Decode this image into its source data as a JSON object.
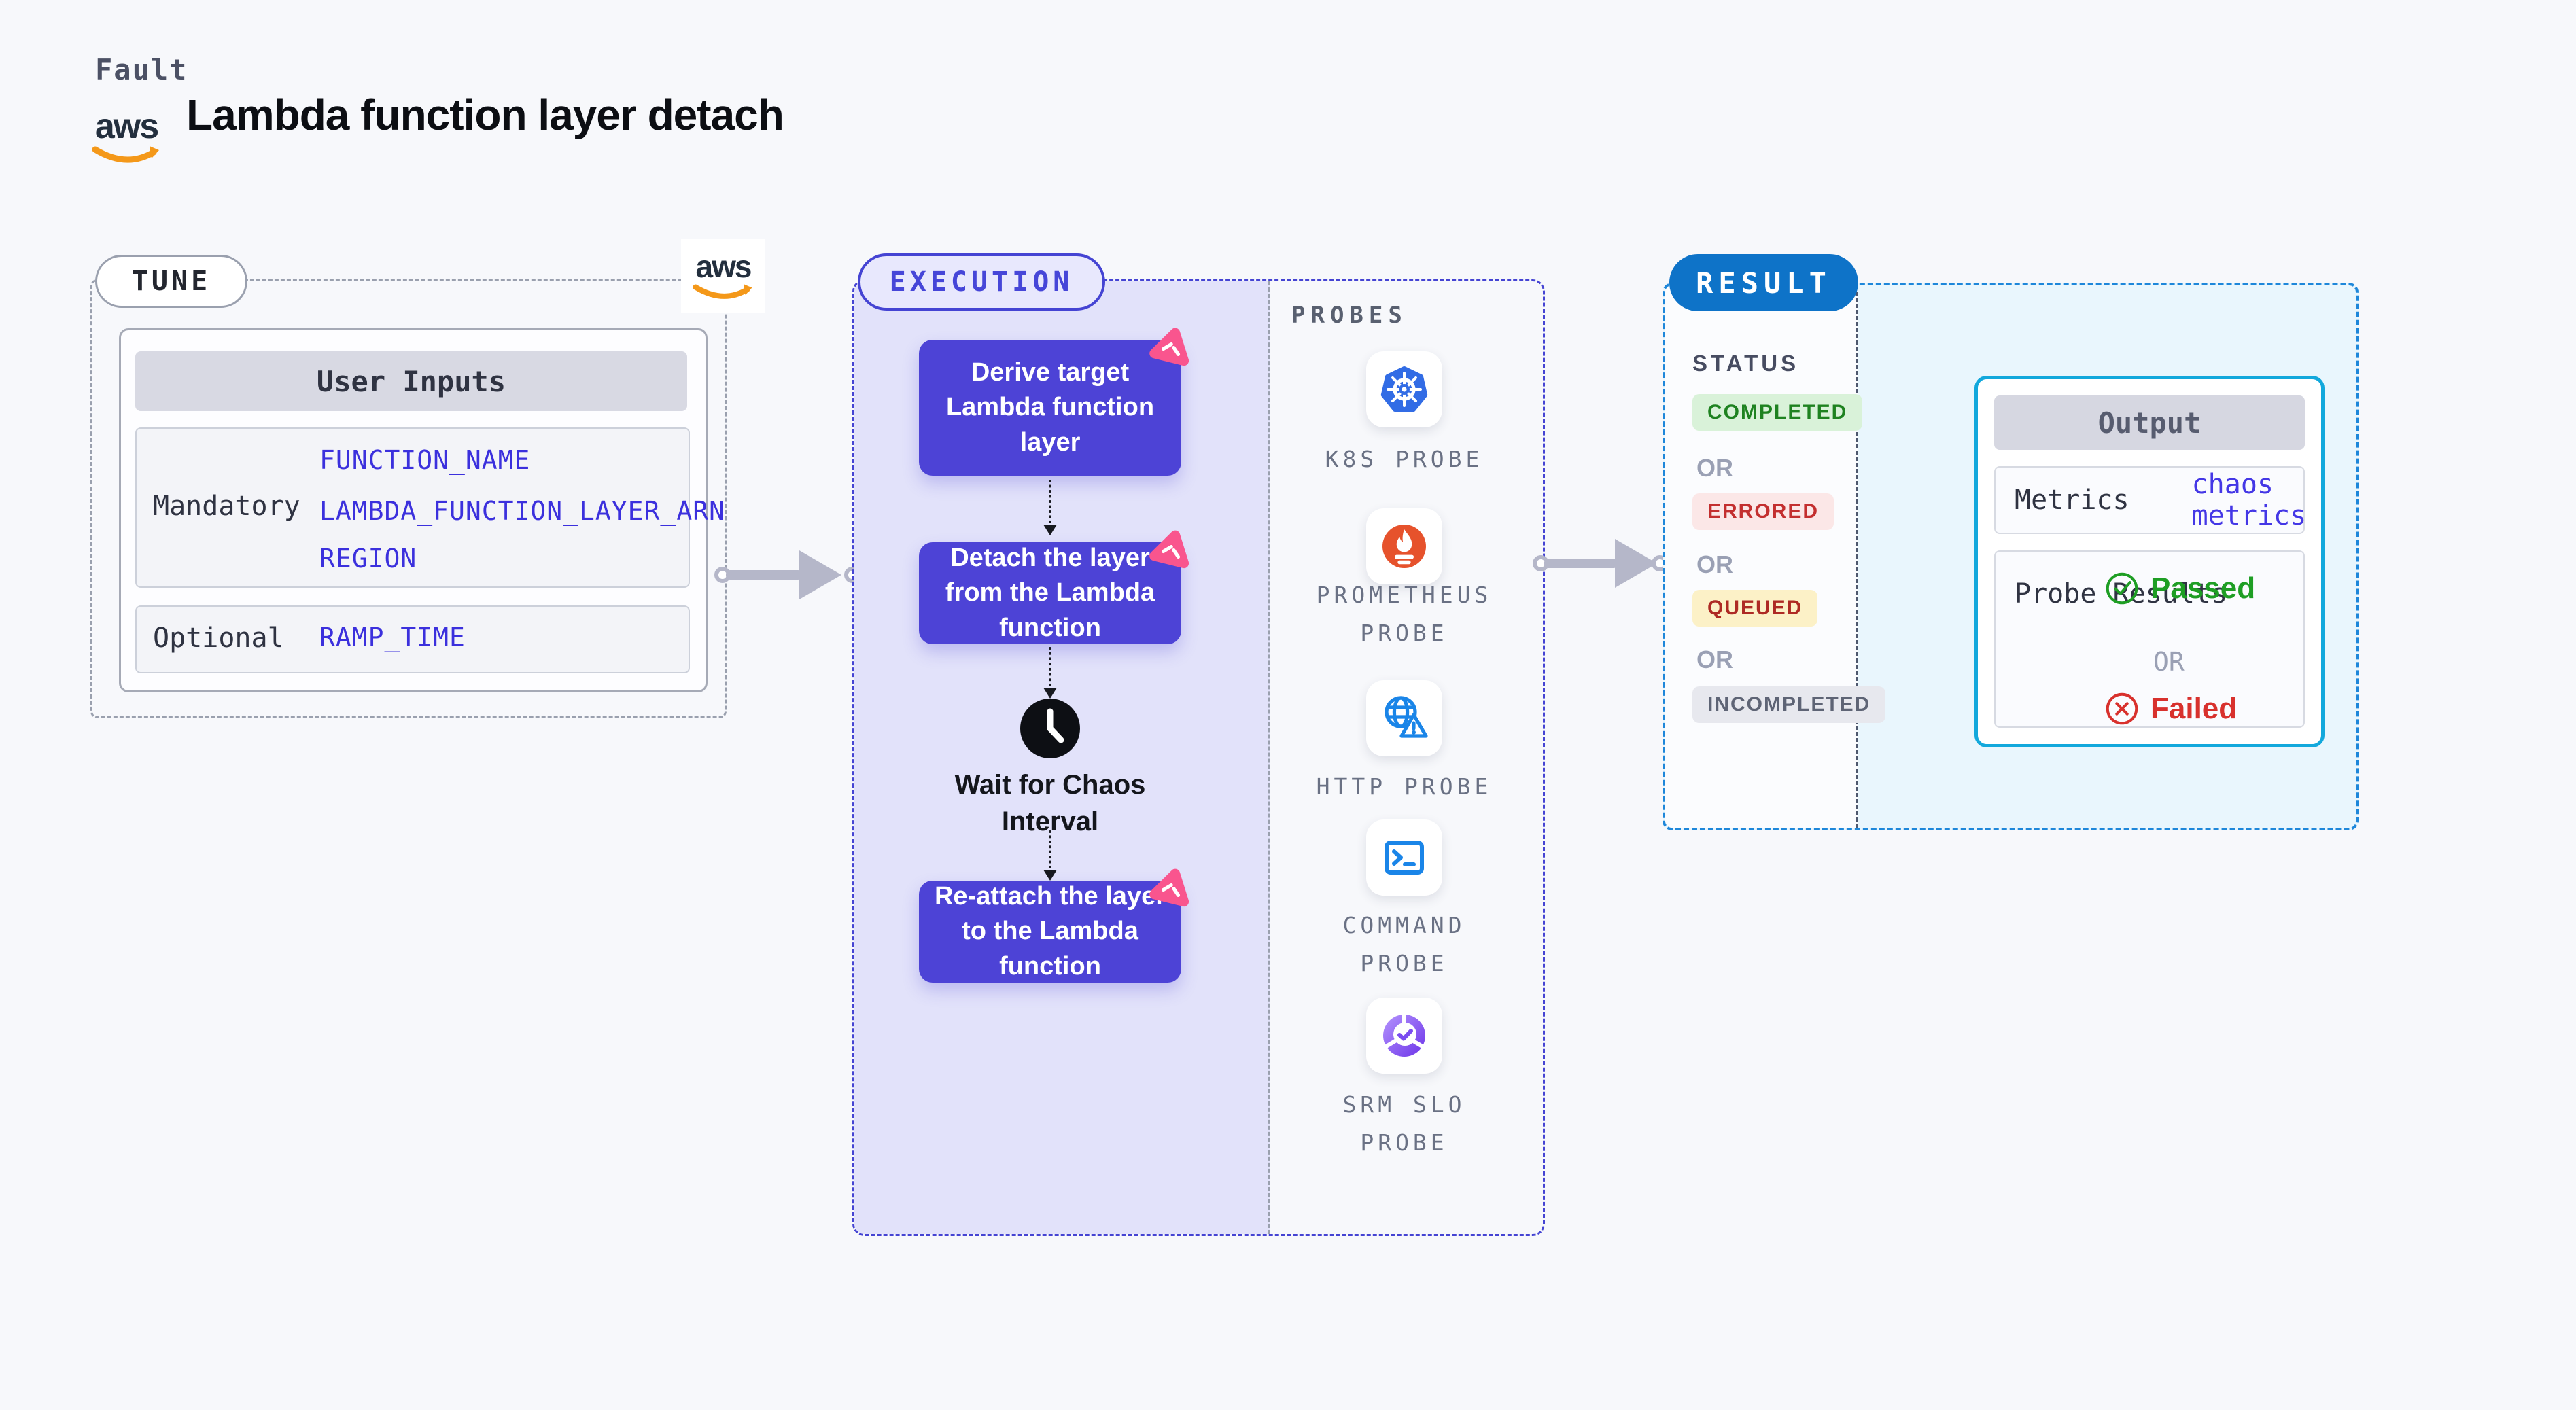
{
  "header": {
    "fault_label": "Fault",
    "title": "Lambda function layer detach",
    "aws_logo_text": "aws"
  },
  "tune": {
    "label": "TUNE",
    "aws_logo_text": "aws",
    "table": {
      "title": "User Inputs",
      "mandatory_label": "Mandatory",
      "mandatory_values": [
        "FUNCTION_NAME",
        "LAMBDA_FUNCTION_LAYER_ARN",
        "REGION"
      ],
      "optional_label": "Optional",
      "optional_values": [
        "RAMP_TIME"
      ]
    }
  },
  "execution": {
    "label": "EXECUTION",
    "nodes": [
      "Derive target Lambda function layer",
      "Detach the layer from the Lambda function",
      "Re-attach the layer to the Lambda function"
    ],
    "wait_label": "Wait for Chaos Interval"
  },
  "probes": {
    "label": "PROBES",
    "items": [
      {
        "icon": "kubernetes-icon",
        "lines": [
          "K8S PROBE"
        ]
      },
      {
        "icon": "prometheus-icon",
        "lines": [
          "PROMETHEUS",
          "PROBE"
        ]
      },
      {
        "icon": "http-icon",
        "lines": [
          "HTTP PROBE"
        ]
      },
      {
        "icon": "command-icon",
        "lines": [
          "COMMAND",
          "PROBE"
        ]
      },
      {
        "icon": "srm-slo-icon",
        "lines": [
          "SRM SLO",
          "PROBE"
        ]
      }
    ]
  },
  "result": {
    "label": "RESULT",
    "status_label": "STATUS",
    "or_label": "OR",
    "statuses": [
      "COMPLETED",
      "ERRORED",
      "QUEUED",
      "INCOMPLETED"
    ],
    "output": {
      "title": "Output",
      "metrics_label": "Metrics",
      "metrics_value": "chaos metrics",
      "probe_results_label": "Probe Results",
      "passed_label": "Passed",
      "failed_label": "Failed"
    }
  },
  "colors": {
    "node_indigo": "#4d43d6",
    "chaos_pink": "#f9558e",
    "aws_orange": "#f49819",
    "result_blue": "#0e73c8",
    "output_border_cyan": "#12a8dc",
    "passed_green": "#1e9e24",
    "failed_red": "#d8312d",
    "env_var_blue": "#3b30dd"
  }
}
